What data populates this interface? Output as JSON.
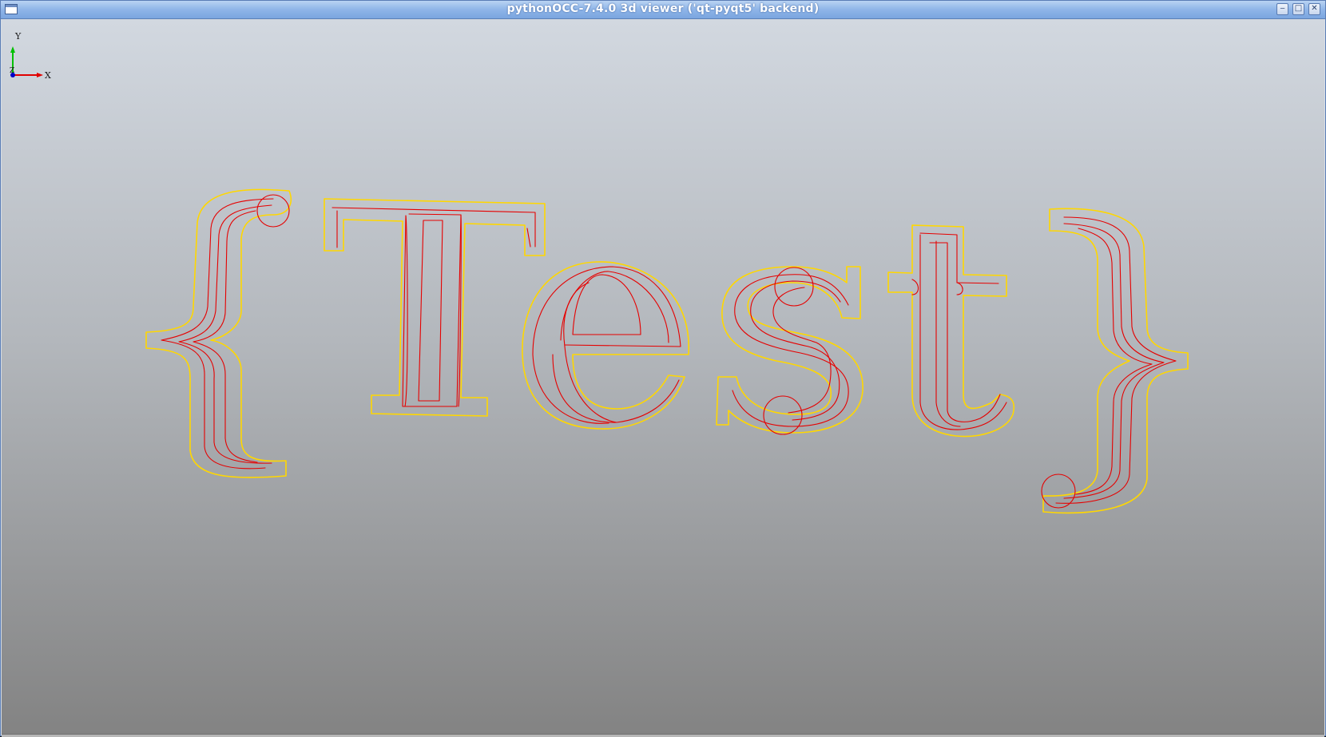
{
  "window": {
    "title": "pythonOCC-7.4.0 3d viewer ('qt-pyqt5' backend)",
    "controls": {
      "minimize_icon": "minimize-icon",
      "maximize_icon": "maximize-icon",
      "close_icon": "close-icon"
    }
  },
  "scene": {
    "text": "{Test}",
    "colors": {
      "outline": "#ffd700",
      "offsets": "#e60000",
      "background_top": "#d2d8e0",
      "background_bottom": "#838383"
    }
  },
  "trihedron": {
    "x_label": "X",
    "y_label": "Y",
    "z_label": "Z",
    "colors": {
      "x": "#e00000",
      "y": "#00c000",
      "z": "#0000c8"
    }
  }
}
